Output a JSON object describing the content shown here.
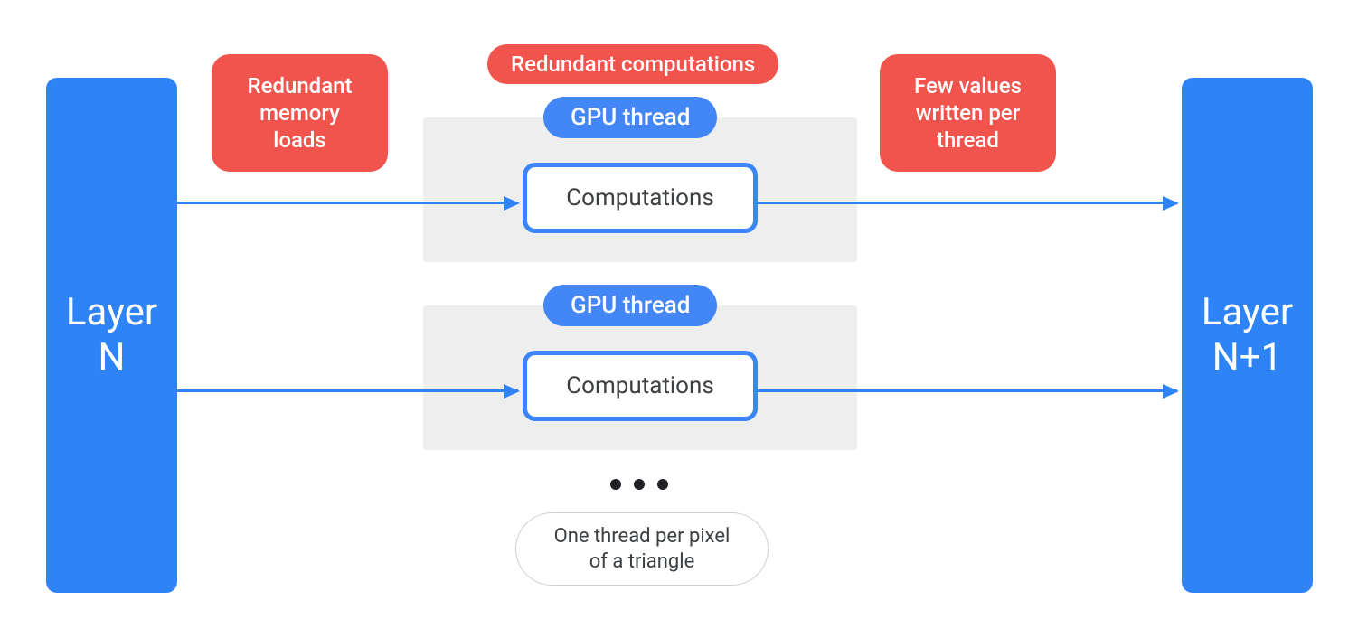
{
  "colors": {
    "blue": "#2e83f7",
    "red": "#f0544c",
    "grey_bg": "#eeeeee",
    "text_dark": "#3c4043"
  },
  "layer_left": {
    "line1": "Layer",
    "line2": "N"
  },
  "layer_right": {
    "line1": "Layer",
    "line2": "N+1"
  },
  "badge_left": {
    "line1": "Redundant",
    "line2": "memory",
    "line3": "loads"
  },
  "badge_top": "Redundant computations",
  "badge_right": {
    "line1": "Few values",
    "line2": "written per",
    "line3": "thread"
  },
  "thread1": {
    "pill": "GPU thread",
    "box": "Computations"
  },
  "thread2": {
    "pill": "GPU thread",
    "box": "Computations"
  },
  "footer_pill": {
    "line1": "One thread per pixel",
    "line2": "of a triangle"
  }
}
